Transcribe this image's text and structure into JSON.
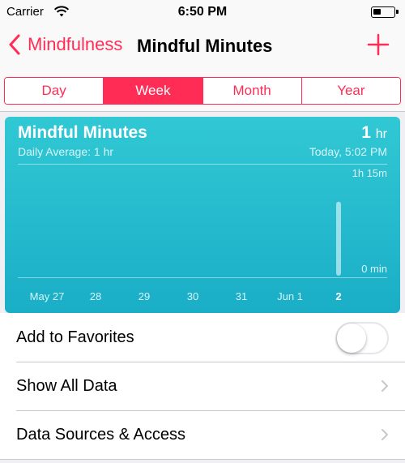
{
  "status_bar": {
    "carrier": "Carrier",
    "time": "6:50 PM",
    "battery_level": 0.25
  },
  "nav": {
    "back_label": "Mindfulness",
    "title": "Mindful Minutes",
    "add_icon": "plus-icon"
  },
  "segments": [
    {
      "label": "Day",
      "active": false
    },
    {
      "label": "Week",
      "active": true
    },
    {
      "label": "Month",
      "active": false
    },
    {
      "label": "Year",
      "active": false
    }
  ],
  "card": {
    "title": "Mindful Minutes",
    "total_value": "1",
    "total_unit": "hr",
    "daily_average": "Daily Average: 1 hr",
    "timestamp": "Today, 5:02 PM"
  },
  "chart_data": {
    "type": "bar",
    "categories": [
      "May 27",
      "28",
      "29",
      "30",
      "31",
      "Jun 1",
      "2"
    ],
    "values": [
      0,
      0,
      0,
      0,
      0,
      0,
      60
    ],
    "y_unit": "minutes",
    "ylim": [
      0,
      75
    ],
    "y_tick_labels": {
      "max": "1h 15m",
      "min": "0 min"
    },
    "highlighted_category": "2",
    "bar_color": "#ffffff",
    "background_colors": [
      "#31c8d4",
      "#1aaec7"
    ]
  },
  "list": {
    "favorites_label": "Add to Favorites",
    "favorites_on": false,
    "show_all_label": "Show All Data",
    "sources_label": "Data Sources & Access"
  },
  "colors": {
    "accent": "#ff2d55",
    "card": "#1aaec7",
    "background": "#efeff4"
  }
}
